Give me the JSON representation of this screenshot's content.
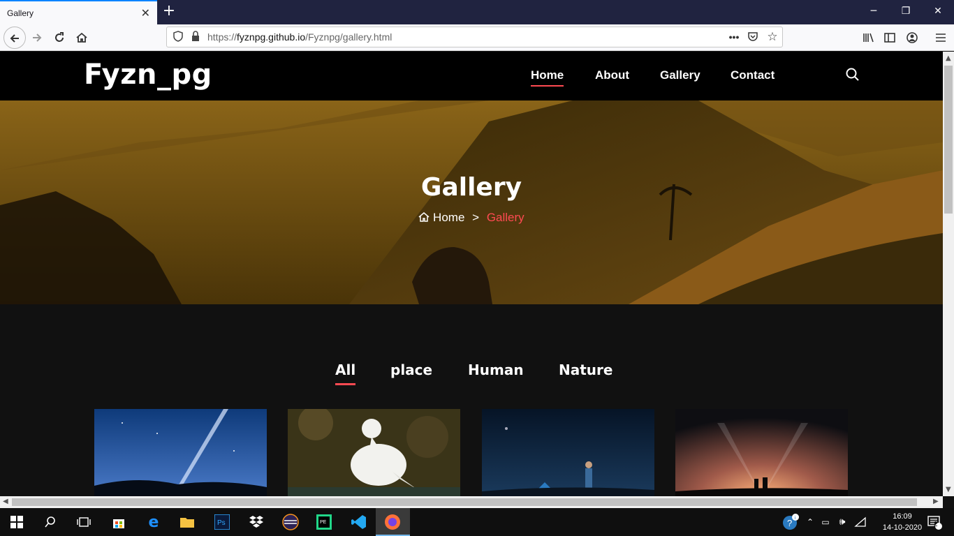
{
  "browser": {
    "tab_title": "Gallery",
    "url_prefix": "https://",
    "url_host": "fyznpg.github.io",
    "url_path": "/Fyznpg/gallery.html"
  },
  "site": {
    "logo": "Fyzn_pg",
    "menu": [
      {
        "label": "Home",
        "active": true
      },
      {
        "label": "About"
      },
      {
        "label": "Gallery"
      },
      {
        "label": "Contact"
      }
    ],
    "hero": {
      "title": "Gallery",
      "crumb_home": "Home",
      "crumb_sep": ">",
      "crumb_current": "Gallery"
    },
    "filters": [
      {
        "label": "All",
        "active": true
      },
      {
        "label": "place"
      },
      {
        "label": "Human"
      },
      {
        "label": "Nature"
      }
    ],
    "accent_color": "#ff4a52"
  },
  "taskbar": {
    "time": "16:09",
    "date": "14-10-2020",
    "notification_count": "2"
  }
}
